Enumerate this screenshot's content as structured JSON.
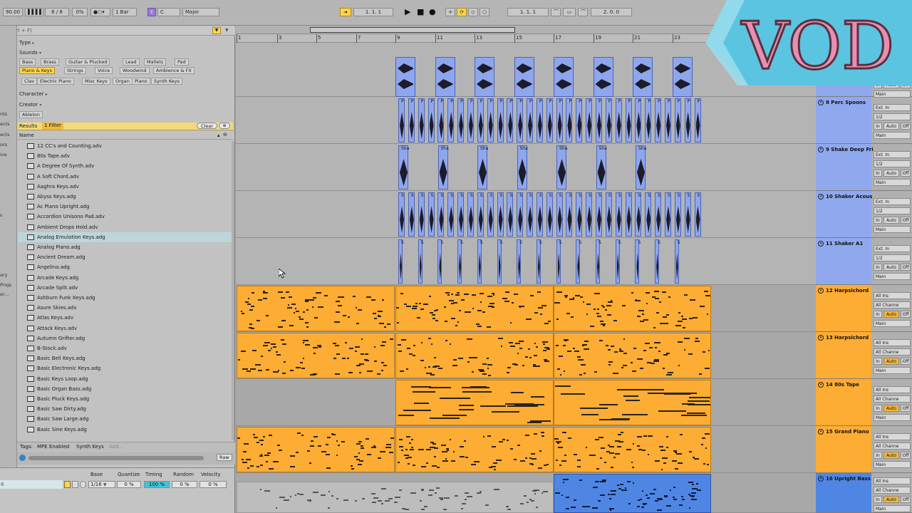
{
  "topbar": {
    "tempo": "90.00",
    "tap": "",
    "time_signature": "6 / 8",
    "groove": "0%",
    "metronome": "1 Bar",
    "key": "C",
    "scale": "Major",
    "position": "1.  1.  1",
    "loop_start": "1.  1.  1",
    "loop_length": "2.  0.  0"
  },
  "browser": {
    "search_placeholder": "ch (Ctrl + F)",
    "places": [
      "nts",
      "ects",
      "ects",
      "ors",
      "ive",
      "s",
      "ary",
      "Proje",
      "er..."
    ],
    "filters": {
      "type_label": "Type",
      "sounds_label": "Sounds",
      "sound_tags_row1": [
        "Bass",
        "Brass",
        "Guitar & Plucked",
        "Lead",
        "Mallets",
        "Pad"
      ],
      "sound_tags_row2": [
        "Piano & Keys",
        "Strings",
        "Voice",
        "Woodwind",
        "Ambience & FX"
      ],
      "sound_tags_row3": [
        "Clav",
        "Electric Piano",
        "Misc Keys",
        "Organ",
        "Piano",
        "Synth Keys"
      ],
      "character_label": "Character",
      "creator_label": "Creator",
      "creator_tag": "Ableton"
    },
    "results_label": "Results",
    "filter_count": "1 Filter",
    "clear_label": "Clear",
    "name_header": "Name",
    "items": [
      "12 CC's and Counting.adv",
      "80s Tape.adv",
      "A Degree Of Synth.adv",
      "A Soft Chord.adv",
      "Aaghra Keys.adv",
      "Abyss Keys.adg",
      "Ac Piano Upright.adg",
      "Accordion Unisono Pad.adv",
      "Ambient Drops Hold.adv",
      "Analog Emulation Keys.adg",
      "Analog Piano.adg",
      "Ancient Dream.adg",
      "Angelina.adg",
      "Arcade Keys.adg",
      "Arcade Split.adv",
      "Ashburn Funk Keys.adg",
      "Asure Skies.adv",
      "Atlas Keys.adv",
      "Attack Keys.adv",
      "Autumn Grifter.adg",
      "B-Stock.adv",
      "Basic Bell Keys.adg",
      "Basic Electronic Keys.adg",
      "Basic Keys Loop.adg",
      "Basic Organ Bass.adg",
      "Basic Pluck Keys.adg",
      "Basic Saw Dirty.adg",
      "Basic Saw Large.adg",
      "Basic Sine Keys.adg"
    ],
    "selected_index": 9,
    "tags_label": "Tags:",
    "tags": [
      "MPE Enabled",
      "Synth Keys"
    ],
    "tags_add": "Add...",
    "raw_label": "Raw"
  },
  "quantize": {
    "headers": [
      "Base",
      "Quantize",
      "Timing",
      "Random",
      "Velocity"
    ],
    "row_label": "6",
    "values": [
      "1/16",
      "0 %",
      "100 %",
      "0 %",
      "0 %"
    ]
  },
  "ruler": {
    "bars": [
      "1",
      "3",
      "5",
      "7",
      "9",
      "11",
      "13",
      "15",
      "17",
      "19",
      "21",
      "23"
    ]
  },
  "tracks": [
    {
      "name": "",
      "input": "",
      "channel": "",
      "monitor": [
        "In",
        "Auto",
        "Off"
      ],
      "output": "Main",
      "color": "#90a8ee"
    },
    {
      "name": "8 Perc Spoons",
      "input": "Ext. In",
      "channel": "1/2",
      "monitor": [
        "In",
        "Auto",
        "Off"
      ],
      "output": "Main",
      "color": "#90a8ee"
    },
    {
      "name": "9 Shake Deep Fri",
      "input": "Ext. In",
      "channel": "1/2",
      "monitor": [
        "In",
        "Auto",
        "Off"
      ],
      "output": "Main",
      "color": "#90a8ee"
    },
    {
      "name": "10 Shaker Acous",
      "input": "Ext. In",
      "channel": "1/2",
      "monitor": [
        "In",
        "Auto",
        "Off"
      ],
      "output": "Main",
      "color": "#90a8ee"
    },
    {
      "name": "11 Shaker A1",
      "input": "Ext. In",
      "channel": "1/2",
      "monitor": [
        "In",
        "Auto",
        "Off"
      ],
      "output": "Main",
      "color": "#90a8ee"
    },
    {
      "name": "12 Harpsichord",
      "input": "All Ins",
      "channel": "All Channe",
      "monitor": [
        "In",
        "Auto",
        "Off"
      ],
      "output": "Main",
      "color": "#fdac34"
    },
    {
      "name": "13 Harpsichord",
      "input": "All Ins",
      "channel": "All Channe",
      "monitor": [
        "In",
        "Auto",
        "Off"
      ],
      "output": "Main",
      "color": "#fdac34"
    },
    {
      "name": "14 80s Tape",
      "input": "All Ins",
      "channel": "All Channe",
      "monitor": [
        "In",
        "Auto",
        "Off"
      ],
      "output": "Main",
      "color": "#fdac34"
    },
    {
      "name": "15 Grand Piano",
      "input": "All Ins",
      "channel": "All Channe",
      "monitor": [
        "In",
        "Auto",
        "Off"
      ],
      "output": "Main",
      "color": "#fdac34"
    },
    {
      "name": "16 Upright Bass",
      "input": "All Ins",
      "channel": "All Channe",
      "monitor": [
        "In",
        "Auto",
        "Off"
      ],
      "output": "Main",
      "color": "#4f86e3"
    }
  ],
  "clip_labels": {
    "perc": "P",
    "shake": "Sha",
    "shaker": "S",
    "shakerA": "S"
  },
  "overlay": {
    "watermark": "VOD",
    "colors": {
      "fill": "#e78fb1",
      "stroke": "#5a3140",
      "banner": "#5bc4e0"
    }
  },
  "colors": {
    "accent_yellow": "#ffd54a",
    "clip_blue": "#8ea6ee",
    "clip_orange": "#fdac34",
    "clip_dark_blue": "#4f86e3",
    "auto_active": "#f6b531"
  }
}
